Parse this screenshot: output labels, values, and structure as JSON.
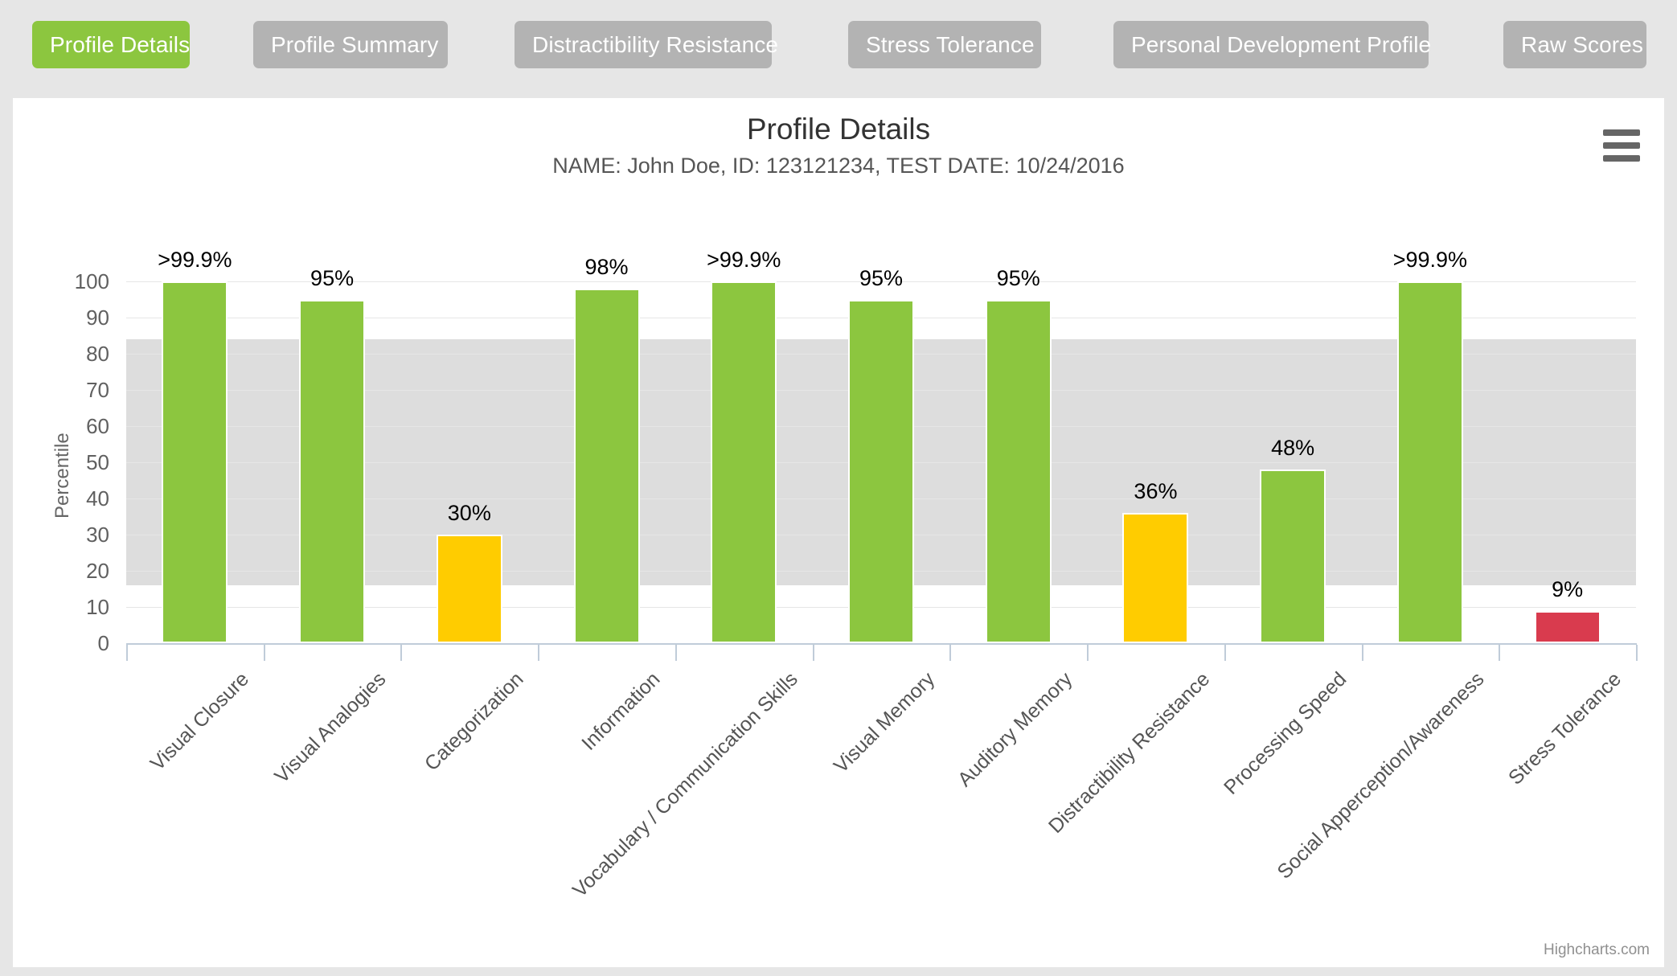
{
  "tabs": [
    {
      "label": "Profile Details",
      "active": true
    },
    {
      "label": "Profile Summary",
      "active": false
    },
    {
      "label": "Distractibility Resistance",
      "active": false
    },
    {
      "label": "Stress Tolerance",
      "active": false
    },
    {
      "label": "Personal Development Profile",
      "active": false
    },
    {
      "label": "Raw Scores",
      "active": false
    }
  ],
  "header": {
    "title": "Profile Details",
    "subtitle": "NAME: John Doe, ID: 123121234, TEST DATE: 10/24/2016",
    "menu_icon": "hamburger-menu-icon"
  },
  "credits": "Highcharts.com",
  "colors": {
    "accent_green": "#8cc63f",
    "bar_green": "#8cc63f",
    "bar_yellow": "#ffcc00",
    "bar_red": "#d93b4e",
    "tab_inactive": "#b3b3b3",
    "page_background": "#e6e6e6",
    "panel_background": "#ffffff",
    "plot_band": "#dddddd",
    "axis_line": "#c0ccd9",
    "gridline": "#e6e6e6"
  },
  "chart_data": {
    "type": "bar",
    "title": "Profile Details",
    "subtitle": "NAME: John Doe, ID: 123121234, TEST DATE: 10/24/2016",
    "xlabel": "",
    "ylabel": "Percentile",
    "ylim": [
      0,
      100
    ],
    "ytick_values": [
      0,
      10,
      20,
      30,
      40,
      50,
      60,
      70,
      80,
      90,
      100
    ],
    "ytick_labels": [
      "0",
      "10",
      "20",
      "30",
      "40",
      "50",
      "60",
      "70",
      "80",
      "90",
      "100"
    ],
    "grid": true,
    "legend": "none",
    "plot_bands": [
      {
        "from": 16,
        "to": 50,
        "color": "#dddddd"
      },
      {
        "from": 50,
        "to": 84,
        "color": "#dddddd"
      }
    ],
    "categories": [
      "Visual Closure",
      "Visual Analogies",
      "Categorization",
      "Information",
      "Vocabulary / Communication Skills",
      "Visual Memory",
      "Auditory Memory",
      "Distractibility Resistance",
      "Processing Speed",
      "Social Apperception/Awareness",
      "Stress Tolerance"
    ],
    "values": [
      100,
      95,
      30,
      98,
      100,
      95,
      95,
      36,
      48,
      100,
      9
    ],
    "data_labels": [
      "&gt;99.9%",
      "95%",
      "30%",
      "98%",
      "&gt;99.9%",
      "95%",
      "95%",
      "36%",
      "48%",
      "&gt;99.9%",
      "9%"
    ],
    "point_colors": [
      "#8cc63f",
      "#8cc63f",
      "#ffcc00",
      "#8cc63f",
      "#8cc63f",
      "#8cc63f",
      "#8cc63f",
      "#ffcc00",
      "#8cc63f",
      "#8cc63f",
      "#d93b4e"
    ]
  }
}
